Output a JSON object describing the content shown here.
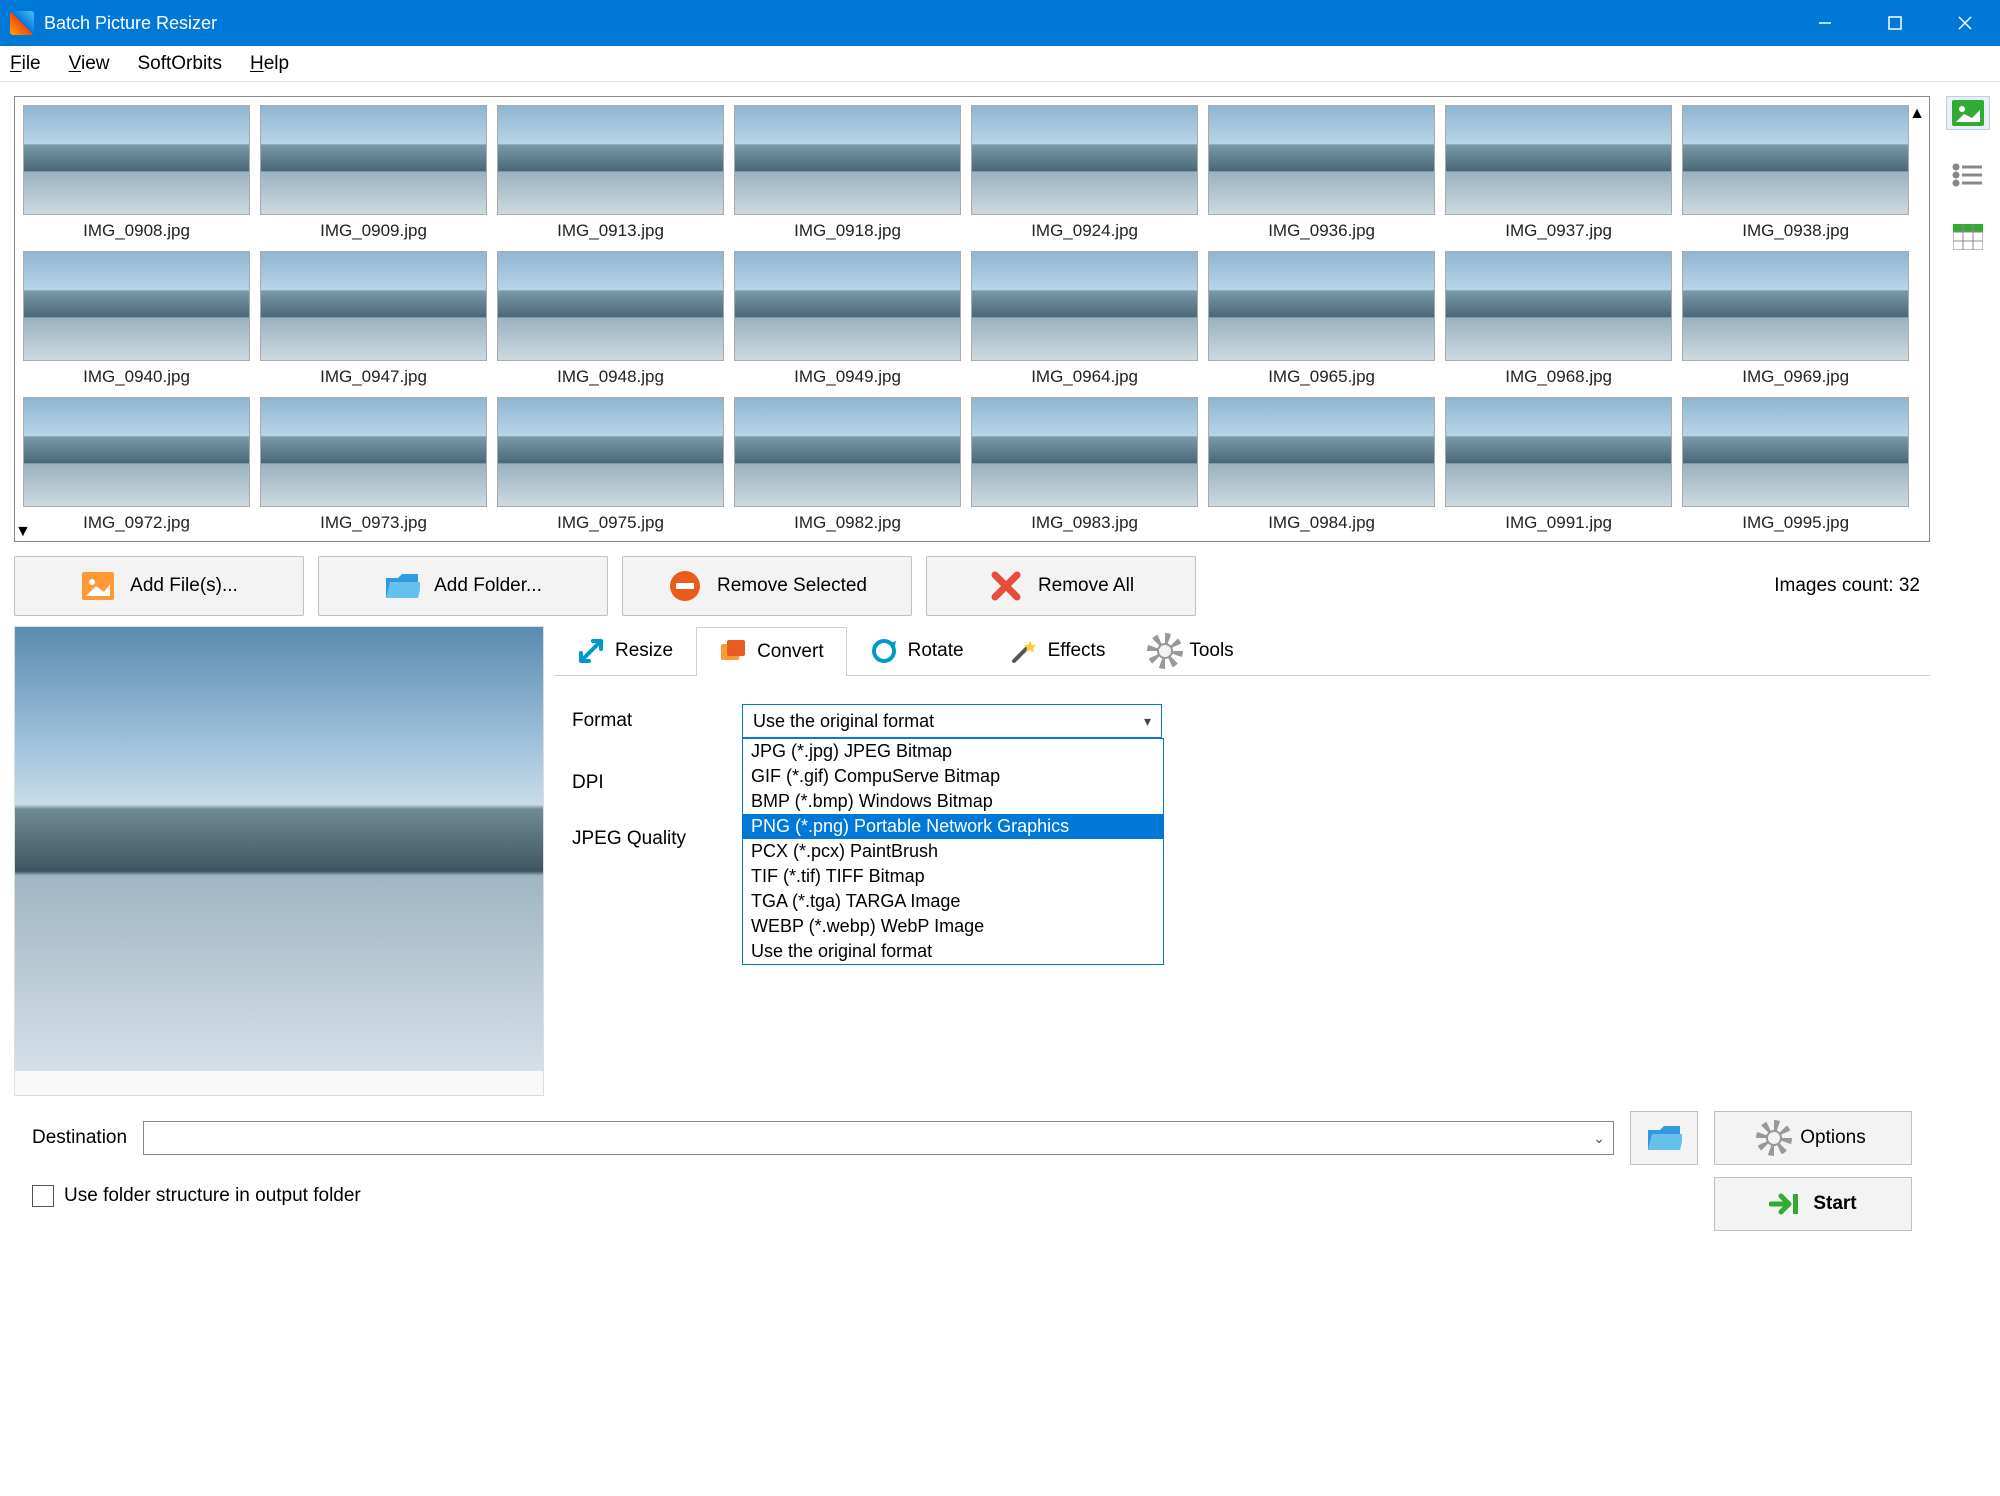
{
  "app": {
    "title": "Batch Picture Resizer"
  },
  "menu": {
    "file": "File",
    "view": "View",
    "softorbits": "SoftOrbits",
    "help": "Help"
  },
  "thumbnails": [
    "IMG_0908.jpg",
    "IMG_0909.jpg",
    "IMG_0913.jpg",
    "IMG_0918.jpg",
    "IMG_0924.jpg",
    "IMG_0936.jpg",
    "IMG_0937.jpg",
    "IMG_0938.jpg",
    "IMG_0940.jpg",
    "IMG_0947.jpg",
    "IMG_0948.jpg",
    "IMG_0949.jpg",
    "IMG_0964.jpg",
    "IMG_0965.jpg",
    "IMG_0968.jpg",
    "IMG_0969.jpg",
    "IMG_0972.jpg",
    "IMG_0973.jpg",
    "IMG_0975.jpg",
    "IMG_0982.jpg",
    "IMG_0983.jpg",
    "IMG_0984.jpg",
    "IMG_0991.jpg",
    "IMG_0995.jpg"
  ],
  "buttons": {
    "add_files": "Add File(s)...",
    "add_folder": "Add Folder...",
    "remove_selected": "Remove Selected",
    "remove_all": "Remove All",
    "options": "Options",
    "start": "Start"
  },
  "images_count": "Images count: 32",
  "tabs": {
    "resize": "Resize",
    "convert": "Convert",
    "rotate": "Rotate",
    "effects": "Effects",
    "tools": "Tools"
  },
  "convert": {
    "format_label": "Format",
    "dpi_label": "DPI",
    "jpeg_label": "JPEG Quality",
    "combo_value": "Use the original format",
    "options": [
      "JPG (*.jpg) JPEG Bitmap",
      "GIF (*.gif) CompuServe Bitmap",
      "BMP (*.bmp) Windows Bitmap",
      "PNG (*.png) Portable Network Graphics",
      "PCX (*.pcx) PaintBrush",
      "TIF (*.tif) TIFF Bitmap",
      "TGA (*.tga) TARGA Image",
      "WEBP (*.webp) WebP Image",
      "Use the original format"
    ],
    "highlighted_index": 3
  },
  "destination": {
    "label": "Destination",
    "value": ""
  },
  "folder_checkbox": "Use folder structure in output folder"
}
